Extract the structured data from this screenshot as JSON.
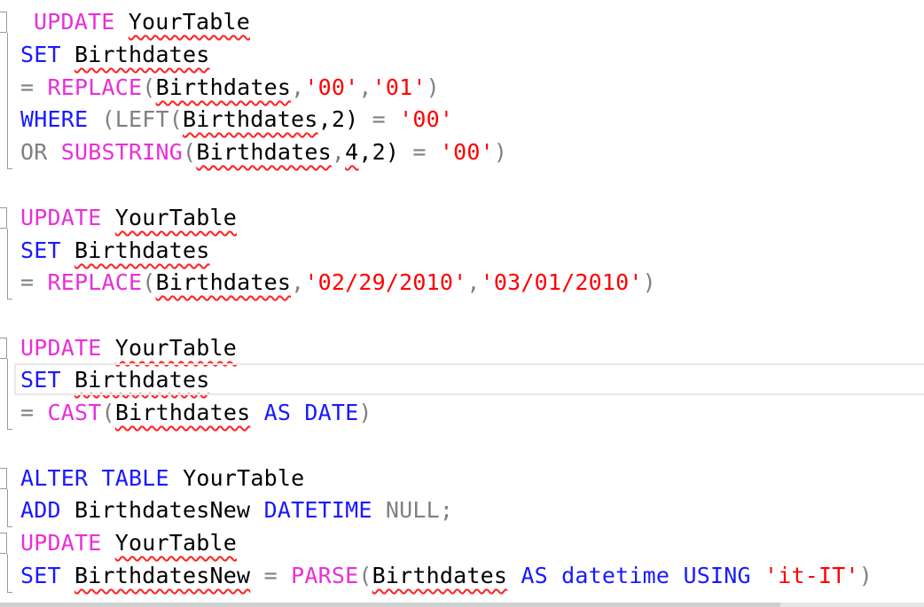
{
  "editor": {
    "lines": [
      [
        {
          "t": "UPDATE",
          "c": "kw-pink"
        },
        {
          "t": " "
        },
        {
          "t": "YourTable",
          "sq": true
        }
      ],
      [
        {
          "t": "SET",
          "c": "kw-blue"
        },
        {
          "t": " "
        },
        {
          "t": "Birthdates",
          "sq": true
        }
      ],
      [
        {
          "t": "=",
          "c": "gray"
        },
        {
          "t": " "
        },
        {
          "t": "REPLACE",
          "c": "kw-pink"
        },
        {
          "t": "(",
          "c": "gray"
        },
        {
          "t": "Birthdates",
          "sq": true
        },
        {
          "t": ",",
          "c": "gray"
        },
        {
          "t": "'00'",
          "c": "str"
        },
        {
          "t": ",",
          "c": "gray"
        },
        {
          "t": "'01'",
          "c": "str"
        },
        {
          "t": ")",
          "c": "gray"
        }
      ],
      [
        {
          "t": "WHERE",
          "c": "kw-blue"
        },
        {
          "t": " "
        },
        {
          "t": "(LEFT(",
          "c": "gray"
        },
        {
          "t": "Birthdates",
          "sq": true
        },
        {
          "t": ",2)"
        },
        {
          "t": " = ",
          "c": "gray"
        },
        {
          "t": "'00'",
          "c": "str"
        }
      ],
      [
        {
          "t": "OR",
          "c": "gray"
        },
        {
          "t": " "
        },
        {
          "t": "SUBSTRING",
          "c": "kw-pink"
        },
        {
          "t": "(",
          "c": "gray"
        },
        {
          "t": "Birthdates",
          "sq": true
        },
        {
          "t": ",",
          "c": "gray"
        },
        {
          "t": "4",
          "sq": true
        },
        {
          "t": ",2)"
        },
        {
          "t": " = ",
          "c": "gray"
        },
        {
          "t": "'00'",
          "c": "str"
        },
        {
          "t": ")",
          "c": "gray"
        }
      ],
      [],
      [
        {
          "t": "UPDATE",
          "c": "kw-pink"
        },
        {
          "t": " "
        },
        {
          "t": "YourTable",
          "sq": true
        }
      ],
      [
        {
          "t": "SET",
          "c": "kw-blue"
        },
        {
          "t": " "
        },
        {
          "t": "Birthdates",
          "sq": true
        }
      ],
      [
        {
          "t": "=",
          "c": "gray"
        },
        {
          "t": " "
        },
        {
          "t": "REPLACE",
          "c": "kw-pink"
        },
        {
          "t": "(",
          "c": "gray"
        },
        {
          "t": "Birthdates",
          "sq": true
        },
        {
          "t": ",",
          "c": "gray"
        },
        {
          "t": "'02/29/2010'",
          "c": "str"
        },
        {
          "t": ",",
          "c": "gray"
        },
        {
          "t": "'03/01/2010'",
          "c": "str"
        },
        {
          "t": ")",
          "c": "gray"
        }
      ],
      [],
      [
        {
          "t": "UPDATE",
          "c": "kw-pink"
        },
        {
          "t": " "
        },
        {
          "t": "YourTable",
          "sq": true
        }
      ],
      [
        {
          "t": "SET",
          "c": "kw-blue"
        },
        {
          "t": " "
        },
        {
          "t": "Birthdates",
          "sq": true
        }
      ],
      [
        {
          "t": "=",
          "c": "gray"
        },
        {
          "t": " "
        },
        {
          "t": "CAST",
          "c": "kw-pink"
        },
        {
          "t": "(",
          "c": "gray"
        },
        {
          "t": "Birthdates",
          "sq": true
        },
        {
          "t": " "
        },
        {
          "t": "AS",
          "c": "kw-blue"
        },
        {
          "t": " "
        },
        {
          "t": "DATE",
          "c": "kw-blue"
        },
        {
          "t": ")",
          "c": "gray"
        }
      ],
      [],
      [
        {
          "t": "ALTER",
          "c": "kw-blue"
        },
        {
          "t": " "
        },
        {
          "t": "TABLE",
          "c": "kw-blue"
        },
        {
          "t": " "
        },
        {
          "t": "YourTable"
        }
      ],
      [
        {
          "t": "ADD",
          "c": "kw-blue"
        },
        {
          "t": " "
        },
        {
          "t": "BirthdatesNew"
        },
        {
          "t": " "
        },
        {
          "t": "DATETIME",
          "c": "kw-blue"
        },
        {
          "t": " "
        },
        {
          "t": "NULL",
          "c": "gray"
        },
        {
          "t": ";",
          "c": "gray"
        }
      ],
      [
        {
          "t": "UPDATE",
          "c": "kw-pink"
        },
        {
          "t": " "
        },
        {
          "t": "YourTable",
          "sq": true
        }
      ],
      [
        {
          "t": "SET",
          "c": "kw-blue"
        },
        {
          "t": " "
        },
        {
          "t": "BirthdatesNew",
          "sq": true
        },
        {
          "t": " = ",
          "c": "gray"
        },
        {
          "t": "PARSE",
          "c": "kw-pink"
        },
        {
          "t": "(",
          "c": "gray"
        },
        {
          "t": "Birthdates",
          "sq": true
        },
        {
          "t": " "
        },
        {
          "t": "AS",
          "c": "kw-blue"
        },
        {
          "t": " "
        },
        {
          "t": "datetime",
          "c": "kw-blue"
        },
        {
          "t": " "
        },
        {
          "t": "USING",
          "c": "kw-blue"
        },
        {
          "t": " "
        },
        {
          "t": "'it-IT'",
          "c": "str"
        },
        {
          "t": ")",
          "c": "gray"
        }
      ]
    ],
    "fold_markers": [
      0,
      6,
      10,
      14,
      16
    ],
    "current_line": 11,
    "colors": {
      "keyword_pink": "#e82fd8",
      "keyword_blue": "#1919ff",
      "operator_gray": "#808080",
      "string_red": "#ff0000",
      "squiggle": "#ff2020"
    }
  }
}
